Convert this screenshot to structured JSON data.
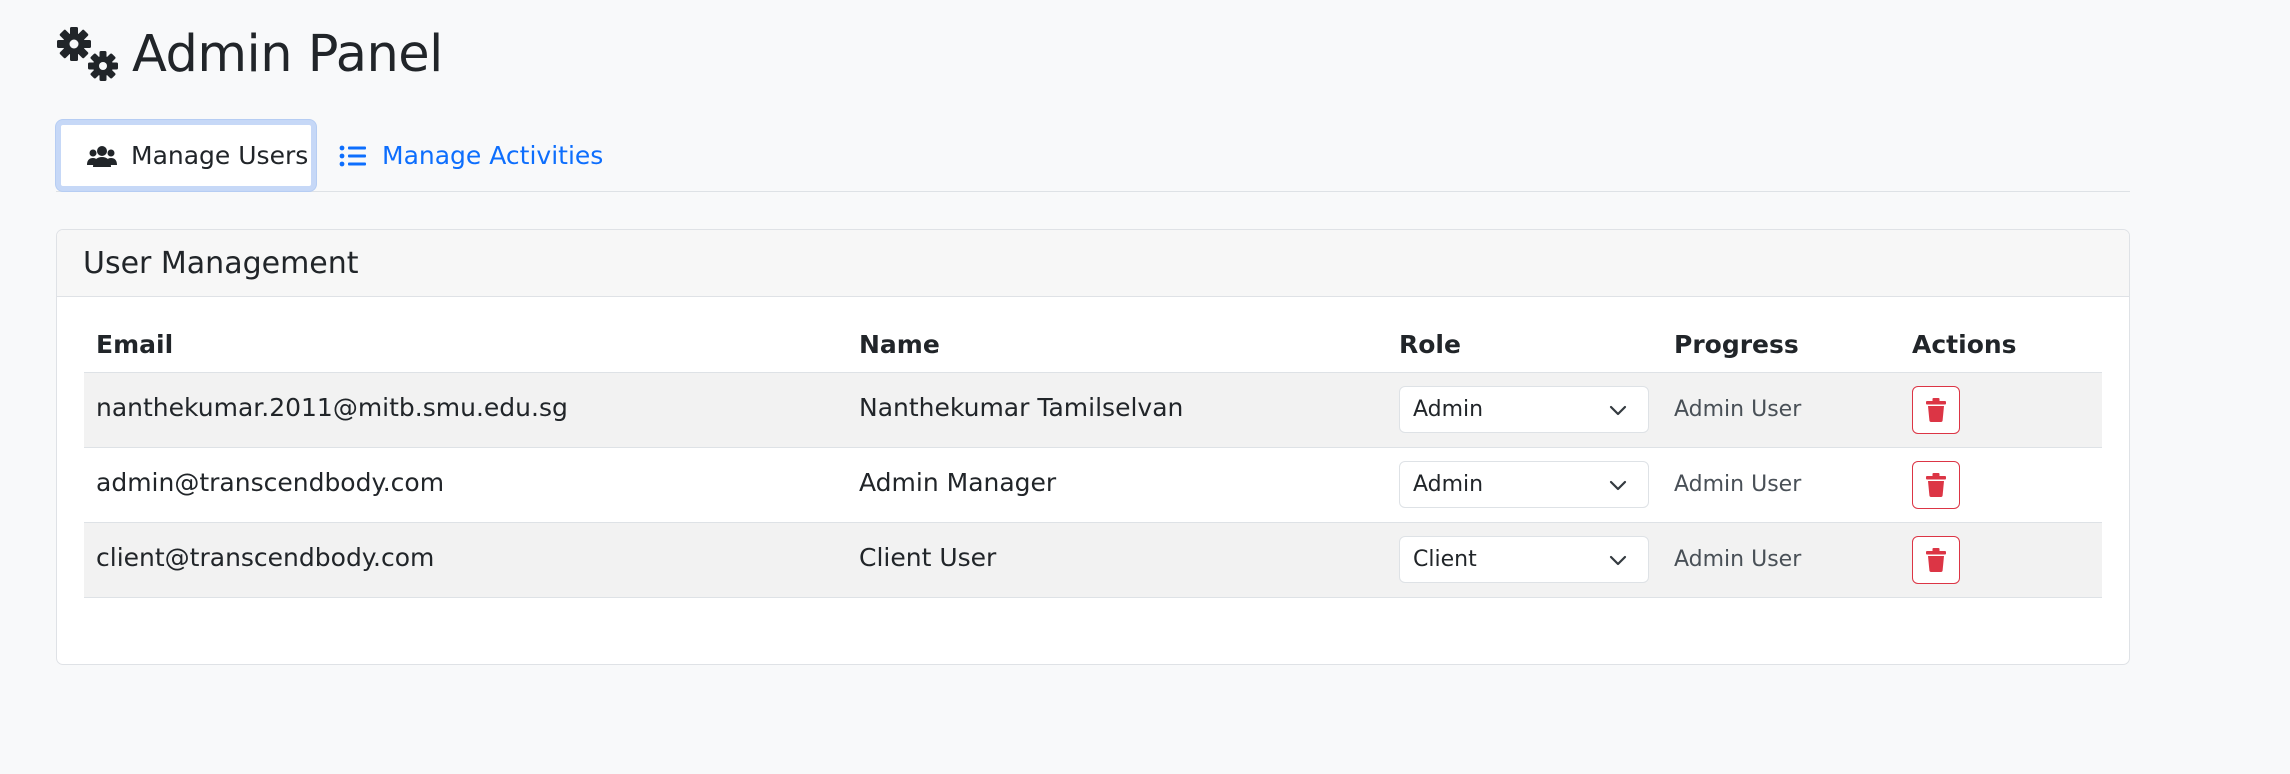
{
  "page": {
    "title": "Admin Panel",
    "title_icon": "gears-icon"
  },
  "tabs": [
    {
      "label": "Manage Users",
      "icon": "users-icon",
      "active": true
    },
    {
      "label": "Manage Activities",
      "icon": "list-icon",
      "active": false
    }
  ],
  "card": {
    "title": "User Management"
  },
  "table": {
    "headers": {
      "email": "Email",
      "name": "Name",
      "role": "Role",
      "progress": "Progress",
      "actions": "Actions"
    },
    "rows": [
      {
        "email": "nanthekumar.2011@mitb.smu.edu.sg",
        "name": "Nanthekumar Tamilselvan",
        "role": "Admin",
        "progress": "Admin User"
      },
      {
        "email": "admin@transcendbody.com",
        "name": "Admin Manager",
        "role": "Admin",
        "progress": "Admin User"
      },
      {
        "email": "client@transcendbody.com",
        "name": "Client User",
        "role": "Client",
        "progress": "Admin User"
      }
    ]
  },
  "colors": {
    "accent": "#0d6efd",
    "danger": "#dc3545",
    "active_tab_border": "#c6d8f7"
  }
}
